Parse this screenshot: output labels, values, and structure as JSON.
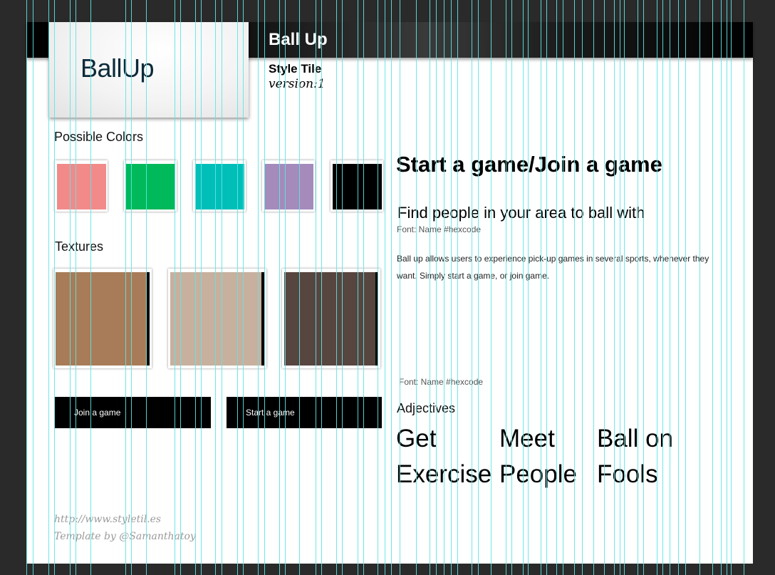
{
  "header": {
    "app_title": "Ball Up",
    "tile_title": "Style Tile",
    "version": "version:1",
    "logo_text": "BallUp"
  },
  "colors": {
    "label": "Possible Colors",
    "swatches": [
      "#f28a8a",
      "#00b95a",
      "#00bfb8",
      "#a48bbc",
      "#000000"
    ]
  },
  "textures": {
    "label": "Textures",
    "items": [
      "#a87c58",
      "#c8b09e",
      "#574540"
    ]
  },
  "buttons": {
    "join": "Join a game",
    "start": "Start a game"
  },
  "content": {
    "heading": "Start a game/Join a game",
    "subheading": "Find people in your area to ball with",
    "font_note_1": "Font: Name #hexcode",
    "body": "Ball up allows users to experience pick-up games in several sports, whenever they want. Simply start a game, or join game.",
    "font_note_2": "Font: Name #hexcode"
  },
  "adjectives": {
    "label": "Adjectives",
    "words": [
      "Get\nExercise",
      "Meet\nPeople",
      "Ball on\nFools"
    ]
  },
  "footer": {
    "url": "http://www.styletil.es",
    "credit": "Template by @Samanthatoy"
  },
  "accent_guides": "#5fe4e4"
}
